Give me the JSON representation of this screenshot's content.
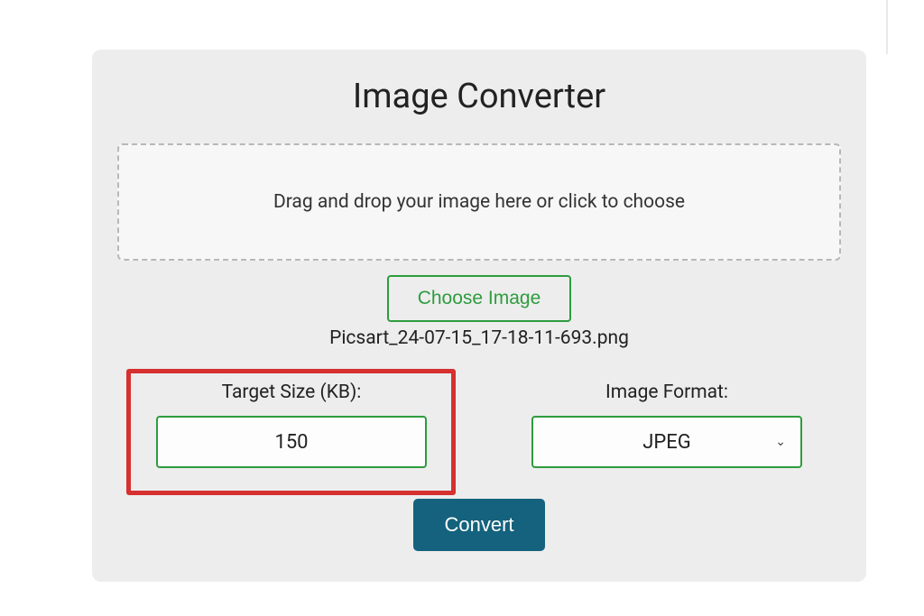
{
  "title": "Image Converter",
  "dropzone": {
    "text": "Drag and drop your image here or click to choose"
  },
  "choose_button": {
    "label": "Choose Image"
  },
  "selected_file": "Picsart_24-07-15_17-18-11-693.png",
  "fields": {
    "target_size": {
      "label": "Target Size (KB):",
      "value": "150"
    },
    "image_format": {
      "label": "Image Format:",
      "value": "JPEG"
    }
  },
  "convert_button": {
    "label": "Convert"
  }
}
